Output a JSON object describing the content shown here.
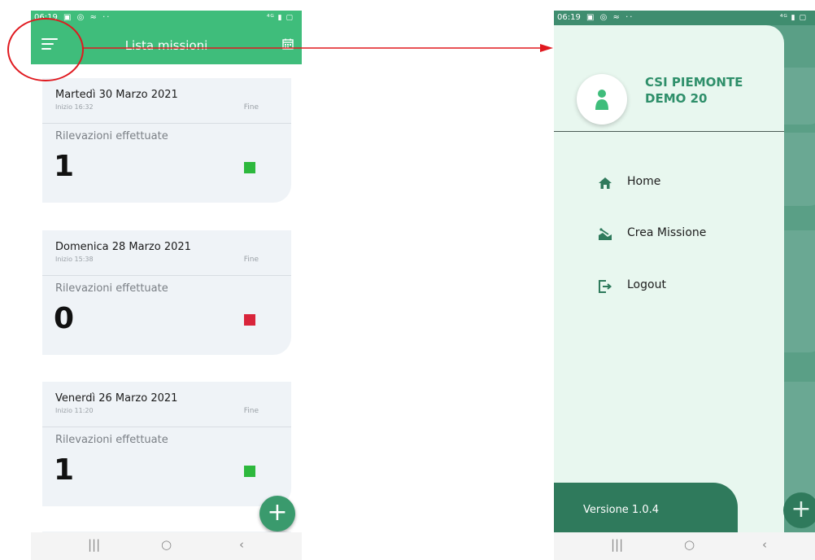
{
  "left": {
    "status": {
      "time": "06:19",
      "icons": "▣ ◎ ≈ ··",
      "right_icons": "⁴ᴳ ▮ ▢"
    },
    "appbar": {
      "title": "Lista missioni"
    },
    "cards": [
      {
        "date": "Martedì 30 Marzo 2021",
        "start": "Inizio 16:32",
        "end": "Fine",
        "label": "Rilevazioni effettuate",
        "count": "1",
        "status_color": "#2db83d"
      },
      {
        "date": "Domenica 28 Marzo 2021",
        "start": "Inizio 15:38",
        "end": "Fine",
        "label": "Rilevazioni effettuate",
        "count": "0",
        "status_color": "#d9243b"
      },
      {
        "date": "Venerdì 26 Marzo 2021",
        "start": "Inizio 11:20",
        "end": "Fine",
        "label": "Rilevazioni effettuate",
        "count": "1",
        "status_color": "#2db83d"
      }
    ],
    "fab": "+",
    "nav": {
      "recent": "|||",
      "home": "○",
      "back": "‹"
    }
  },
  "right": {
    "status": {
      "time": "06:19",
      "icons": "▣ ◎ ≈ ··",
      "right_icons": "⁴ᴳ ▮ ▢"
    },
    "user": {
      "line1": "CSI PIEMONTE",
      "line2": "DEMO 20"
    },
    "menu": [
      {
        "label": "Home",
        "icon": "home-icon"
      },
      {
        "label": "Crea Missione",
        "icon": "create-mission-icon"
      },
      {
        "label": "Logout",
        "icon": "logout-icon"
      }
    ],
    "version": "Versione 1.0.4",
    "fab": "+",
    "nav": {
      "recent": "|||",
      "home": "○",
      "back": "‹"
    }
  },
  "colors": {
    "appbar_green": "#3fbd7b",
    "drawer_bg": "#e8f7ef",
    "drawer_accent": "#2f7a5c",
    "annotation_red": "#e0191f"
  }
}
